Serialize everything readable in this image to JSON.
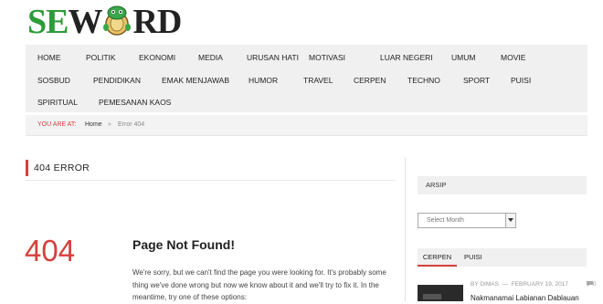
{
  "logo": {
    "s": "SE",
    "w": "W",
    "rd": "RD"
  },
  "nav": {
    "rows": [
      [
        "HOME",
        "POLITIK",
        "EKONOMI",
        "MEDIA",
        "URUSAN HATI",
        "MOTIVASI",
        "LUAR NEGERI",
        "UMUM",
        "MOVIE"
      ],
      [
        "SOSBUD",
        "PENDIDIKAN",
        "EMAK MENJAWAB",
        "HUMOR",
        "TRAVEL",
        "CERPEN",
        "TECHNO",
        "SPORT",
        "PUISI"
      ],
      [
        "SPIRITUAL",
        "PEMESANAN KAOS"
      ]
    ]
  },
  "breadcrumb": {
    "label": "YOU ARE AT:",
    "home": "Home",
    "sep": "»",
    "current": "Error 404"
  },
  "main": {
    "heading": "404 ERROR",
    "big_code": "404",
    "not_found_title": "Page Not Found!",
    "not_found_text": "We're sorry, but we can't find the page you were looking for. It's probably some thing we've done wrong but now we know about it and we'll try to fix it. In the meantime, try one of these options:"
  },
  "sidebar": {
    "archive_title": "ARSIP",
    "archive_select": "Select Month",
    "tabs": [
      "CERPEN",
      "PUISI"
    ],
    "post": {
      "author": "BY DIMAS",
      "dash": "—",
      "date": "FEBRUARY 19, 2017",
      "comments": "0",
      "title": "Nakmanamai Labianan Dablauan"
    }
  },
  "colors": {
    "accent": "#d5403c",
    "logo_green": "#2e9b3a",
    "nav_bg": "#f0f0f0"
  }
}
